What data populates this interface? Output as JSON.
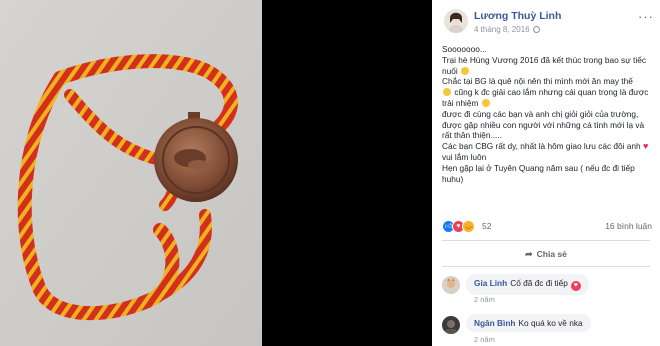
{
  "post": {
    "author": "Lương Thuỳ Linh",
    "timestamp": "4 tháng 8, 2016",
    "text_lines": [
      "Sooooooo...",
      "Trại hè Hùng Vương 2016 đã kết thúc trong bao sự tiếc nuối",
      "Chắc tại BG là quê nội nên thi mình mới ăn may thế",
      "cũng k đc giải cao lắm nhưng cái quan trọng là được trải nhiệm",
      "được đi cùng các bạn và anh chị giỏi giỏi của trường, được gặp nhiều con người với những cá tính mới lạ và rất thân thiện.....",
      "Các bạn CBG rất dy, nhất là hôm giao lưu các đôi anh",
      "vui lắm luôn",
      "Hẹn gặp lại ở Tuyên Quang năm sau ( nếu đc đi tiếp huhu)"
    ]
  },
  "reactions": {
    "icons": [
      "like-icon",
      "love-icon",
      "haha-icon"
    ],
    "count": "52",
    "comments": "16 bình luận"
  },
  "actions": {
    "share_label": "Chia sẻ"
  },
  "comments": [
    {
      "name": "Gia Linh",
      "text": "Cố đã đc đi tiếp",
      "time": "2 năm"
    },
    {
      "name": "Ngân Bình",
      "text": "Ko quá ko về nka",
      "time": "2 năm"
    }
  ],
  "colors": {
    "link": "#385898",
    "like": "#1877f2",
    "love": "#f33e58",
    "haha": "#f7b125"
  }
}
